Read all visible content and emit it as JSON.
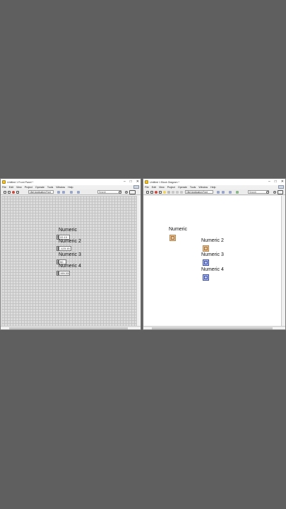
{
  "front_panel": {
    "title": "Untitled 1 Front Panel *",
    "menu": [
      "File",
      "Edit",
      "View",
      "Project",
      "Operate",
      "Tools",
      "Window",
      "Help"
    ],
    "font": "15pt Application Font",
    "search_placeholder": "Search",
    "controls": [
      {
        "label": "Numeric",
        "value": "22.13"
      },
      {
        "label": "Numeric 2",
        "value": "-123.15"
      },
      {
        "label": "Numeric 3",
        "value": "50"
      },
      {
        "label": "Numeric 4",
        "value": "155.333"
      }
    ]
  },
  "block_diagram": {
    "title": "Untitled 1 Block Diagram *",
    "menu": [
      "File",
      "Edit",
      "View",
      "Project",
      "Operate",
      "Tools",
      "Window",
      "Help"
    ],
    "font": "15pt Application Font",
    "search_placeholder": "Search",
    "terminals": [
      {
        "label": "Numeric",
        "type": "DBL"
      },
      {
        "label": "Numeric 2",
        "type": "DBL"
      },
      {
        "label": "Numeric 3",
        "type": "I32"
      },
      {
        "label": "Numeric 4",
        "type": "I32"
      }
    ]
  },
  "window_controls": {
    "minimize": "–",
    "maximize": "□",
    "close": "✕"
  },
  "colors": {
    "background": "#5f5f5f",
    "front_panel_grid": "#dcdcdc",
    "block_diagram_bg": "#ffffff",
    "dbl_terminal": "#e8c59a",
    "i32_terminal": "#b9c4ee"
  }
}
